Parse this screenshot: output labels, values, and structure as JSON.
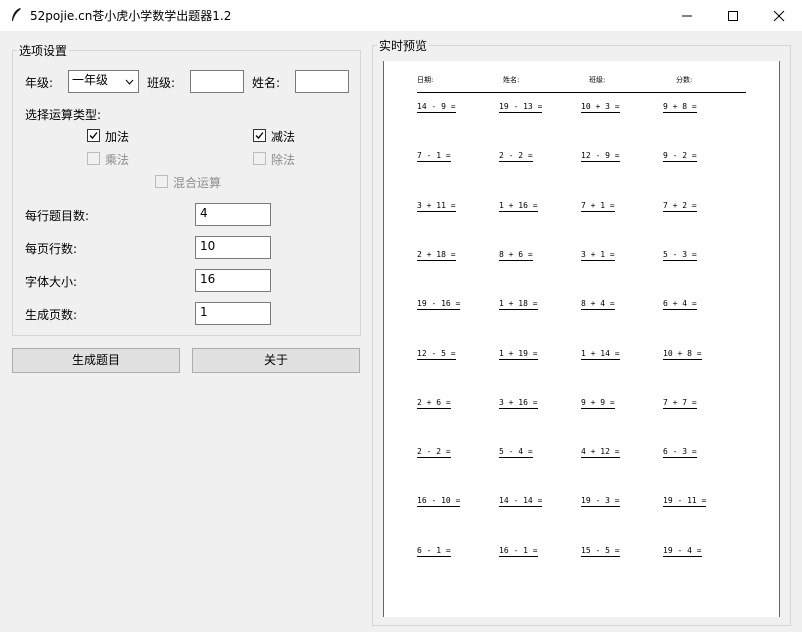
{
  "window": {
    "title": "52pojie.cn苍小虎小学数学出题器1.2",
    "controls": [
      "minimize",
      "maximize",
      "close"
    ]
  },
  "options": {
    "group_title": "选项设置",
    "grade_label": "年级:",
    "grade_value": "一年级",
    "class_label": "班级:",
    "class_value": "",
    "name_label": "姓名:",
    "name_value": "",
    "op_type_label": "选择运算类型:",
    "ops": {
      "add": {
        "label": "加法",
        "checked": true,
        "enabled": true
      },
      "sub": {
        "label": "减法",
        "checked": true,
        "enabled": true
      },
      "mul": {
        "label": "乘法",
        "checked": false,
        "enabled": false
      },
      "div": {
        "label": "除法",
        "checked": false,
        "enabled": false
      },
      "mixed": {
        "label": "混合运算",
        "checked": false,
        "enabled": false
      }
    },
    "per_row_label": "每行题目数:",
    "per_row_value": "4",
    "rows_per_page_label": "每页行数:",
    "rows_per_page_value": "10",
    "font_size_label": "字体大小:",
    "font_size_value": "16",
    "pages_label": "生成页数:",
    "pages_value": "1"
  },
  "buttons": {
    "generate": "生成题目",
    "about": "关于"
  },
  "preview": {
    "group_title": "实时预览",
    "headers": [
      "日期:",
      "姓名:",
      "班级:",
      "分数:"
    ],
    "rows": [
      [
        "14 - 9 =",
        "19 - 13 =",
        "10 + 3 =",
        "9 + 8 ="
      ],
      [
        "7 - 1 =",
        "2 - 2 =",
        "12 - 9 =",
        "9 - 2 ="
      ],
      [
        "3 + 11 =",
        "1 + 16 =",
        "7 + 1 =",
        "7 + 2 ="
      ],
      [
        "2 + 18 =",
        "8 + 6 =",
        "3 + 1 =",
        "5 - 3 ="
      ],
      [
        "19 - 16 =",
        "1 + 18 =",
        "8 + 4 =",
        "6 + 4 ="
      ],
      [
        "12 - 5 =",
        "1 + 19 =",
        "1 + 14 =",
        "10 + 8 ="
      ],
      [
        "2 + 6 =",
        "3 + 16 =",
        "9 + 9 =",
        "7 + 7 ="
      ],
      [
        "2 - 2 =",
        "5 - 4 =",
        "4 + 12 =",
        "6 - 3 ="
      ],
      [
        "16 - 10 =",
        "14 - 14 =",
        "19 - 3 =",
        "19 - 11 ="
      ],
      [
        "6 - 1 =",
        "16 - 1 =",
        "15 - 5 =",
        "19 - 4 ="
      ]
    ]
  }
}
